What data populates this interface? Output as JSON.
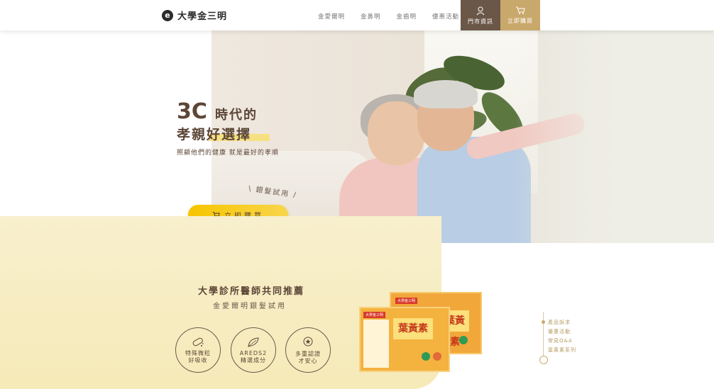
{
  "header": {
    "logo_text": "大學金三明",
    "nav": [
      "金愛爾明",
      "金鼻明",
      "金齒明",
      "優惠活動"
    ],
    "store_label": "門市資訊",
    "buy_label": "立即購買"
  },
  "hero": {
    "headline_big": "3C",
    "headline_rest": "時代的",
    "headline_line2": "孝親好選擇",
    "subline": "照顧他們的健康 就是最好的孝順",
    "trial_note": "\\ 銀髮試用 /",
    "buy_button": "立即購買"
  },
  "recommend": {
    "title": "大學診所醫師共同推薦",
    "subtitle": "金愛爾明銀髮試用",
    "badges": [
      {
        "line1": "特殊微粒",
        "line2": "好吸收"
      },
      {
        "line1": "AREDS2",
        "line2": "精選成分"
      },
      {
        "line1": "多重認證",
        "line2": "才安心"
      }
    ]
  },
  "product": {
    "name": "葉黃素",
    "tag": "大學金三明"
  },
  "side_nav": [
    "產品訴求",
    "優惠活動",
    "常見Q&A",
    "葉黃素系列"
  ],
  "colors": {
    "brown": "#6b5748",
    "gold": "#c9a86b",
    "yellow": "#f6c500"
  }
}
